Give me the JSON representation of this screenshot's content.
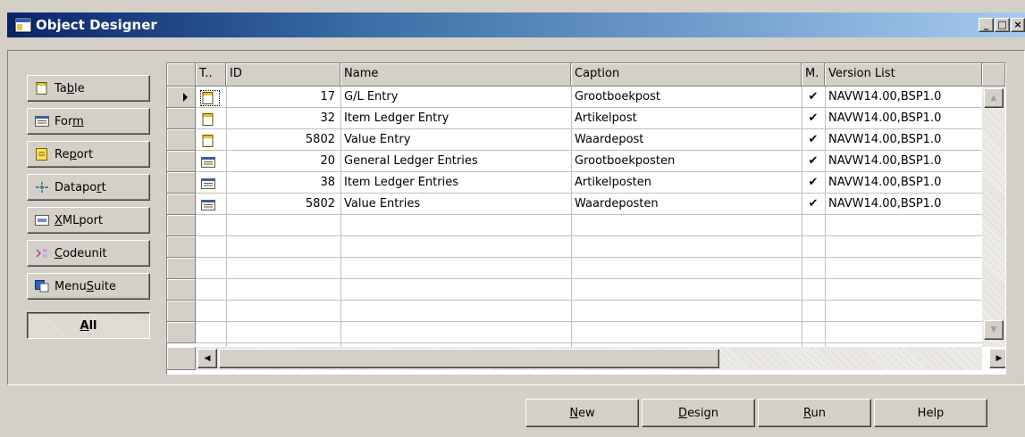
{
  "window": {
    "title": "Object Designer",
    "min_glyph": "_",
    "max_glyph": "□",
    "close_glyph": "×"
  },
  "type_buttons": [
    {
      "label": "Table",
      "icon": "table-icon",
      "accel_index": 2
    },
    {
      "label": "Form",
      "icon": "form-icon",
      "accel_index": 3
    },
    {
      "label": "Report",
      "icon": "report-icon",
      "accel_index": 2
    },
    {
      "label": "Dataport",
      "icon": "dataport-icon",
      "accel_index": 6
    },
    {
      "label": "XMLport",
      "icon": "xmlport-icon",
      "accel_index": 0
    },
    {
      "label": "Codeunit",
      "icon": "codeunit-icon",
      "accel_index": 0
    },
    {
      "label": "MenuSuite",
      "icon": "menusuite-icon",
      "accel_index": 4
    },
    {
      "label": "All",
      "icon": "",
      "accel_index": 0
    }
  ],
  "grid": {
    "headers": {
      "type": "T..",
      "id": "ID",
      "name": "Name",
      "caption": "Caption",
      "modified": "M.",
      "version": "Version List"
    },
    "rows": [
      {
        "type_icon": "table-icon",
        "id": "17",
        "name": "G/L Entry",
        "caption": "Grootboekpost",
        "modified": "✔",
        "version": "NAVW14.00,BSP1.0",
        "current": true
      },
      {
        "type_icon": "table-icon",
        "id": "32",
        "name": "Item Ledger Entry",
        "caption": "Artikelpost",
        "modified": "✔",
        "version": "NAVW14.00,BSP1.0",
        "current": false
      },
      {
        "type_icon": "table-icon",
        "id": "5802",
        "name": "Value Entry",
        "caption": "Waardepost",
        "modified": "✔",
        "version": "NAVW14.00,BSP1.0",
        "current": false
      },
      {
        "type_icon": "form-icon",
        "id": "20",
        "name": "General Ledger Entries",
        "caption": "Grootboekposten",
        "modified": "✔",
        "version": "NAVW14.00,BSP1.0",
        "current": false
      },
      {
        "type_icon": "form-icon",
        "id": "38",
        "name": "Item Ledger Entries",
        "caption": "Artikelposten",
        "modified": "✔",
        "version": "NAVW14.00,BSP1.0",
        "current": false
      },
      {
        "type_icon": "form-icon",
        "id": "5802",
        "name": "Value Entries",
        "caption": "Waardeposten",
        "modified": "✔",
        "version": "NAVW14.00,BSP1.0",
        "current": false
      }
    ],
    "empty_rows": 6
  },
  "bottom_buttons": [
    {
      "label": "New",
      "accel_index": 0
    },
    {
      "label": "Design",
      "accel_index": 0
    },
    {
      "label": "Run",
      "accel_index": 0
    },
    {
      "label": "Help",
      "accel_index": -1
    }
  ]
}
